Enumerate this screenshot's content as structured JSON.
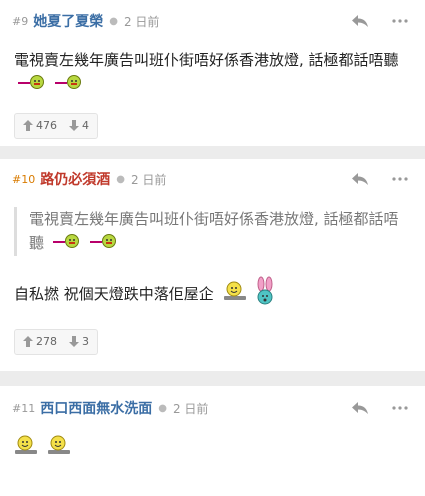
{
  "posts": [
    {
      "num": "#9",
      "user": "她夏了夏榮",
      "time": "2 日前",
      "content": "電視賣左幾年廣告叫班仆街唔好係香港放燈, 話極都話唔聽",
      "up": "476",
      "down": "4"
    },
    {
      "num": "#10",
      "user": "路仍必須酒",
      "time": "2 日前",
      "quote": "電視賣左幾年廣告叫班仆街唔好係香港放燈, 話極都話唔聽",
      "content": "自私撚 祝個天燈跌中落佢屋企",
      "up": "278",
      "down": "3"
    },
    {
      "num": "#11",
      "user": "西口西面無水洗面",
      "time": "2 日前"
    }
  ],
  "icons": {
    "reply": "reply-icon",
    "more": "more-icon",
    "up": "thumb-up-icon",
    "down": "thumb-down-icon"
  }
}
